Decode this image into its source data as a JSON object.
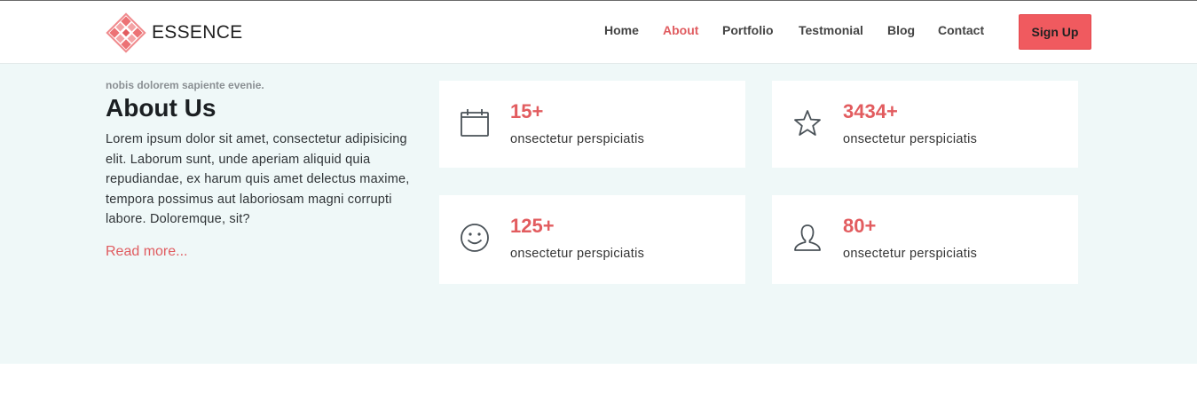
{
  "brand": {
    "name": "ESSENCE",
    "logo_icon": "diamond-lattice-logo",
    "logo_color": "#f08a8d"
  },
  "nav": {
    "items": [
      {
        "label": "Home",
        "active": false
      },
      {
        "label": "About",
        "active": true
      },
      {
        "label": "Portfolio",
        "active": false
      },
      {
        "label": "Testmonial",
        "active": false
      },
      {
        "label": "Blog",
        "active": false
      },
      {
        "label": "Contact",
        "active": false
      }
    ],
    "signup_label": "Sign Up"
  },
  "about": {
    "kicker": "nobis dolorem sapiente evenie.",
    "title": "About Us",
    "body": "Lorem ipsum dolor sit amet, consectetur adipisicing elit. Laborum sunt, unde aperiam aliquid quia repudiandae, ex harum quis amet delectus maxime, tempora possimus aut laboriosam magni corrupti labore. Doloremque, sit?",
    "read_more": "Read more..."
  },
  "stats": [
    {
      "value": "15+",
      "label": "onsectetur perspiciatis",
      "icon": "calendar-icon"
    },
    {
      "value": "3434+",
      "label": "onsectetur perspiciatis",
      "icon": "star-icon"
    },
    {
      "value": "125+",
      "label": "onsectetur perspiciatis",
      "icon": "smiley-icon"
    },
    {
      "value": "80+",
      "label": "onsectetur perspiciatis",
      "icon": "user-icon"
    }
  ],
  "colors": {
    "accent": "#f05a5f",
    "accent_text": "#e25c5f",
    "section_bg": "#eff8f8"
  }
}
